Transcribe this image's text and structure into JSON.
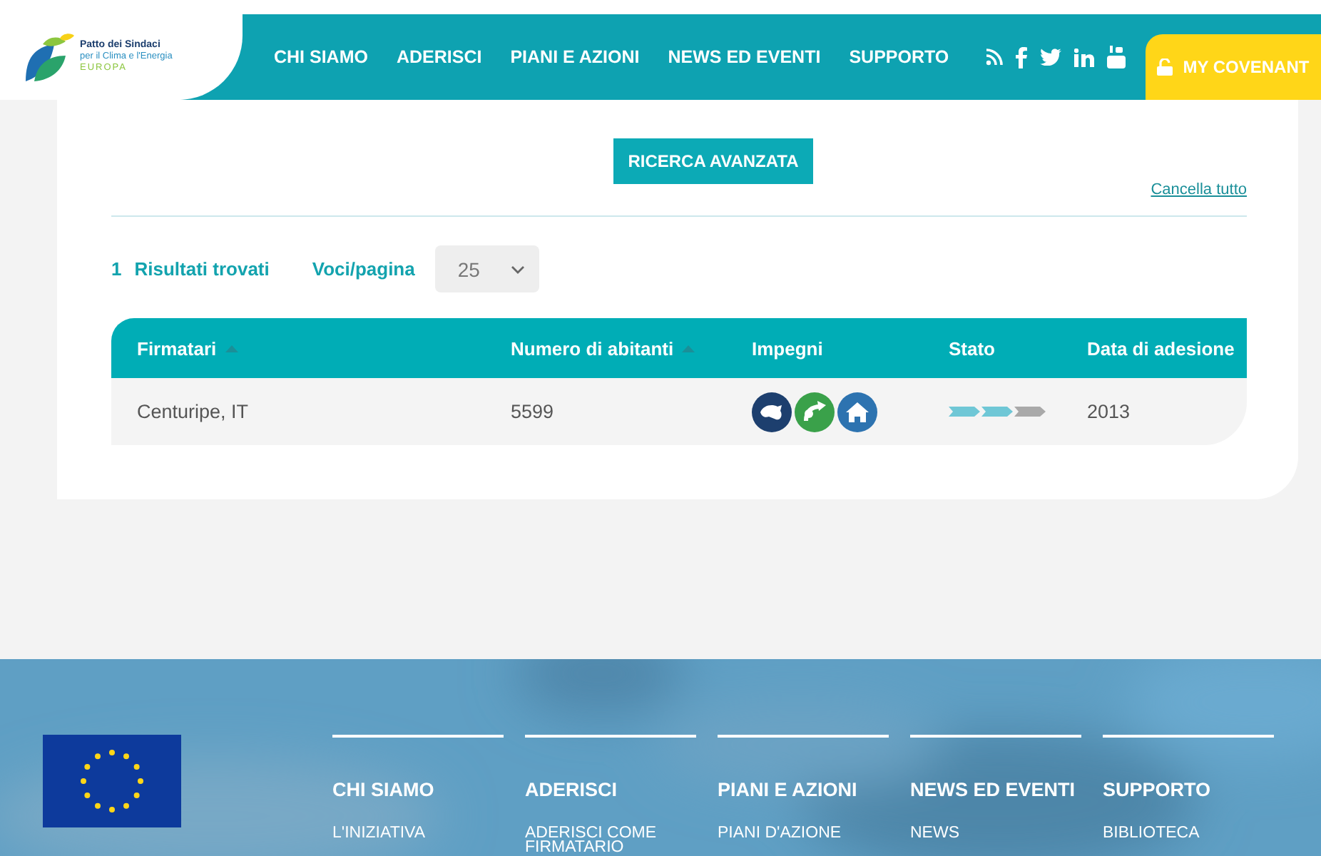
{
  "header": {
    "logo": {
      "name": "Patto dei Sindaci",
      "subtitle": "per il Clima e l'Energia",
      "region": "EUROPA"
    },
    "nav": [
      "CHI SIAMO",
      "ADERISCI",
      "PIANI E AZIONI",
      "NEWS ED EVENTI",
      "SUPPORTO"
    ],
    "my_covenant": "MY COVENANT"
  },
  "search_button": "RICERCA AVANZATA",
  "clear_link": "Cancella tutto",
  "results": {
    "count": "1",
    "label": "Risultati trovati"
  },
  "per_page": {
    "label": "Voci/pagina",
    "value": "25"
  },
  "table": {
    "columns": [
      {
        "label": "Firmatari",
        "sortable": true
      },
      {
        "label": "Numero di abitanti",
        "sortable": true
      },
      {
        "label": "Impegni",
        "sortable": false
      },
      {
        "label": "Stato",
        "sortable": false
      },
      {
        "label": "Data di adesione",
        "sortable": false
      }
    ],
    "rows": [
      {
        "firmatario": "Centuripe, IT",
        "abitanti": "5599",
        "impegni": [
          {
            "kind": "mitigation"
          },
          {
            "kind": "adaptation"
          },
          {
            "kind": "energy_poverty"
          }
        ],
        "stato": [
          {
            "done": true
          },
          {
            "done": true
          },
          {
            "done": false
          }
        ],
        "data": "2013"
      }
    ]
  },
  "footer": {
    "columns": [
      {
        "heading": "CHI SIAMO",
        "links": [
          "L'INIZIATIVA"
        ]
      },
      {
        "heading": "ADERISCI",
        "links": [
          "ADERISCI COME FIRMATARIO"
        ]
      },
      {
        "heading": "PIANI E AZIONI",
        "links": [
          "PIANI D'AZIONE"
        ]
      },
      {
        "heading": "NEWS ED EVENTI",
        "links": [
          "NEWS"
        ]
      },
      {
        "heading": "SUPPORTO",
        "links": [
          "BIBLIOTECA"
        ]
      }
    ]
  }
}
